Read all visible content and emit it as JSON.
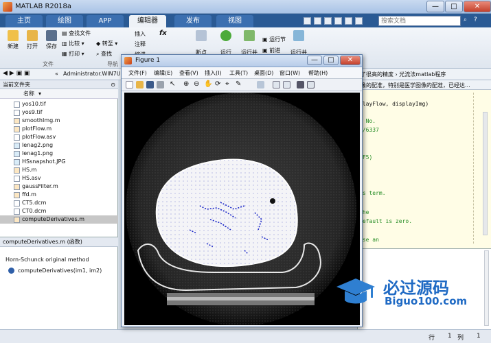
{
  "window": {
    "title": "MATLAB R2018a",
    "minimize": "—",
    "maximize": "□",
    "close": "✕"
  },
  "tabs": [
    {
      "label": "主页"
    },
    {
      "label": "绘图"
    },
    {
      "label": "APP"
    },
    {
      "label": "编辑器"
    },
    {
      "label": "发布"
    },
    {
      "label": "视图"
    }
  ],
  "search": {
    "placeholder": "搜索文档"
  },
  "toolstrip": {
    "new": "新建",
    "open": "打开",
    "save": "保存",
    "find_files": "查找文件",
    "compare": "比较",
    "print": "打印",
    "goto": "转至",
    "find": "查找",
    "insert": "插入",
    "comment": "注释",
    "indent": "缩进",
    "fx": "fx",
    "breakpoints": "断点",
    "run": "运行",
    "run_advance": "运行并",
    "run_section": "运行节",
    "advance": "前进",
    "run_advance2": "运行并",
    "section_file": "文件",
    "section_nav": "导航"
  },
  "address": {
    "path": "Administrator.WIN7U",
    "right_text": "了很高的精度 › 光流法matlab程序",
    "hint": "像的配准，特别是医学图像的配准，已经达..."
  },
  "filebrowser": {
    "header": "当前文件夹",
    "col_name": "名称",
    "files": [
      "yos10.tif",
      "yos9.tif",
      "smoothImg.m",
      "plotFlow.m",
      "plotFlow.asv",
      "lenag2.png",
      "lenag1.png",
      "HSsnapshot.JPG",
      "HS.m",
      "HS.asv",
      "gaussFilter.m",
      "ffd.m",
      "CT5.dcm",
      "CT0.dcm",
      "computeDerivatives.m"
    ]
  },
  "details": {
    "header": "computeDerivatives.m  (函数)",
    "desc": "Horn-Schunck original method",
    "func": "computeDerivatives(im1, im2)"
  },
  "editor": {
    "lines": [
      "playFlow, displayImg)",
      "",
      ", No.",
      "t/6337",
      "",
      "",
      "",
      "",
      "(F5)",
      "",
      "",
      "es term.",
      "",
      "",
      "the",
      "",
      "default is zero.",
      "",
      "",
      "use an"
    ]
  },
  "figure": {
    "title": "Figure 1",
    "menus": [
      "文件(F)",
      "编辑(E)",
      "查看(V)",
      "插入(I)",
      "工具(T)",
      "桌面(D)",
      "窗口(W)",
      "帮助(H)"
    ]
  },
  "status": {
    "line_label": "行",
    "line": "1",
    "col_label": "列",
    "col": "1"
  },
  "watermark": {
    "cn": "必过源码",
    "en": "Biguo100.com"
  }
}
